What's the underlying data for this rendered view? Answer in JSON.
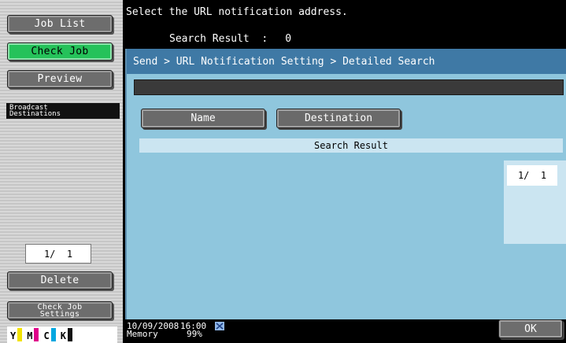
{
  "sidebar": {
    "job_list": "Job List",
    "check_job": "Check Job",
    "preview": "Preview",
    "tab_label": "Broadcast\nDestinations",
    "page": "1/  1",
    "delete": "Delete",
    "check_job_settings": "Check Job\nSettings"
  },
  "toner": [
    {
      "label": "Y",
      "color": "#f2e200"
    },
    {
      "label": "M",
      "color": "#e0008a"
    },
    {
      "label": "C",
      "color": "#00a7e0"
    },
    {
      "label": "K",
      "color": "#111111"
    }
  ],
  "header": {
    "message": "Select the URL notification address.",
    "search_result_label": "Search Result  :",
    "search_result_count": "0"
  },
  "main": {
    "breadcrumb": "Send > URL Notification Setting > Detailed Search",
    "search_value": "",
    "tabs": {
      "name": "Name",
      "destination": "Destination"
    },
    "result_header": "Search Result",
    "page_indicator": "1/  1"
  },
  "status": {
    "date": "10/09/2008",
    "time": "16:00",
    "memory_label": "Memory",
    "memory_value": "99%",
    "ok": "OK"
  },
  "colors": {
    "panel": "#8fc6dd",
    "breadcrumb_bar": "#3f79a5",
    "check_job_green": "#25c25a"
  }
}
